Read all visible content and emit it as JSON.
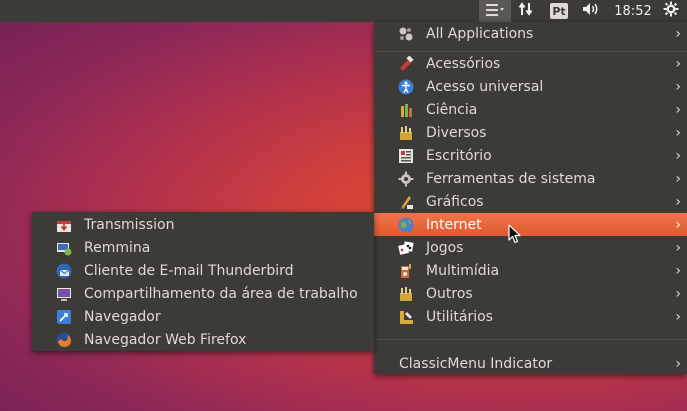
{
  "panel": {
    "keyboard_layout": "Pt",
    "clock": "18:52",
    "icons": [
      "menu-icon",
      "network-arrows-icon",
      "volume-icon",
      "gear-icon"
    ]
  },
  "main_menu": {
    "items": [
      {
        "label": "All Applications",
        "icon": "all-apps-icon"
      },
      {
        "label": "Acessórios",
        "icon": "accessories-icon"
      },
      {
        "label": "Acesso universal",
        "icon": "accessibility-icon"
      },
      {
        "label": "Ciência",
        "icon": "science-icon"
      },
      {
        "label": "Diversos",
        "icon": "misc-icon"
      },
      {
        "label": "Escritório",
        "icon": "office-icon"
      },
      {
        "label": "Ferramentas de sistema",
        "icon": "system-tools-icon"
      },
      {
        "label": "Gráficos",
        "icon": "graphics-icon"
      },
      {
        "label": "Internet",
        "icon": "internet-icon",
        "highlighted": true
      },
      {
        "label": "Jogos",
        "icon": "games-icon"
      },
      {
        "label": "Multimídia",
        "icon": "multimedia-icon"
      },
      {
        "label": "Outros",
        "icon": "others-icon"
      },
      {
        "label": "Utilitários",
        "icon": "utilities-icon"
      }
    ],
    "footer": {
      "label": "ClassicMenu Indicator"
    },
    "arrow_glyph": "›"
  },
  "sub_menu": {
    "items": [
      {
        "label": "Transmission",
        "icon": "transmission-icon"
      },
      {
        "label": "Remmina",
        "icon": "remmina-icon"
      },
      {
        "label": "Cliente de E-mail Thunderbird",
        "icon": "thunderbird-icon"
      },
      {
        "label": "Compartilhamento da área de trabalho",
        "icon": "desktop-sharing-icon"
      },
      {
        "label": "Navegador",
        "icon": "browser-icon"
      },
      {
        "label": "Navegador Web Firefox",
        "icon": "firefox-icon"
      }
    ]
  },
  "colors": {
    "panel_bg": "#3c3b37",
    "menu_bg": "#3c3b37",
    "highlight": "#e95420",
    "text": "#dfdbd2"
  }
}
